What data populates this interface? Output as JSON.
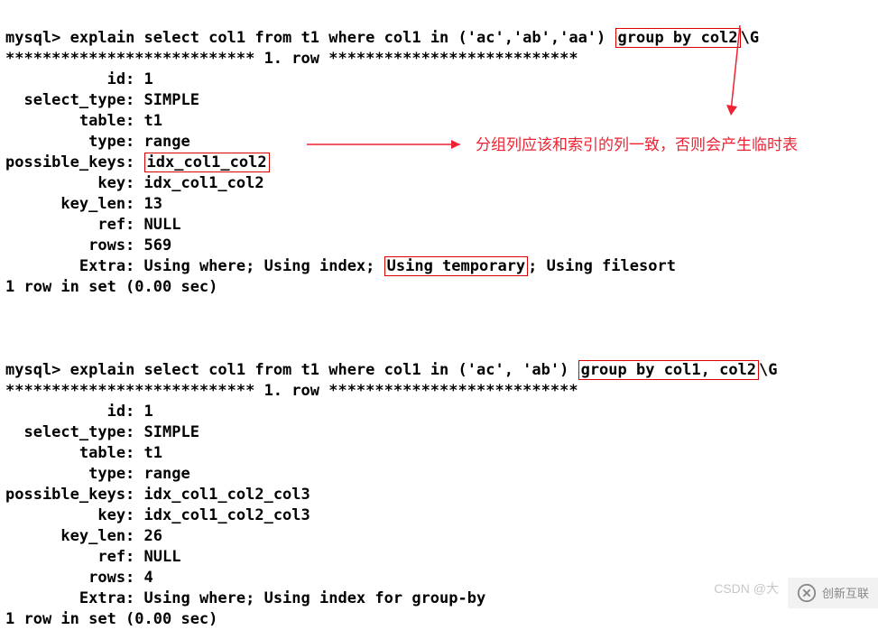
{
  "q1": {
    "prompt": "mysql> ",
    "sql_before": "explain select col1 from t1 where col1 in ('ac','ab','aa') ",
    "sql_box": "group by col2",
    "sql_after": "\\G",
    "sep": "*************************** 1. row ***************************",
    "rows": {
      "id": "1",
      "select_type": "SIMPLE",
      "table": "t1",
      "type": "range",
      "possible_keys": "idx_col1_col2",
      "key": "idx_col1_col2",
      "key_len": "13",
      "ref": "NULL",
      "rows_n": "569",
      "extra_before": "Using where; Using index; ",
      "extra_box": "Using temporary",
      "extra_after": "; Using filesort"
    },
    "timing": "1 row in set (0.00 sec)"
  },
  "q2": {
    "prompt": "mysql> ",
    "sql_before": "explain select col1 from t1 where col1 in ('ac', 'ab') ",
    "sql_box": "group by col1, col2",
    "sql_after": "\\G",
    "sep": "*************************** 1. row ***************************",
    "rows": {
      "id": "1",
      "select_type": "SIMPLE",
      "table": "t1",
      "type": "range",
      "possible_keys": "idx_col1_col2_col3",
      "key": "idx_col1_col2_col3",
      "key_len": "26",
      "ref": "NULL",
      "rows_n": "4",
      "extra": "Using where; Using index for group-by"
    },
    "timing": "1 row in set (0.00 sec)"
  },
  "labels": {
    "id": "           id: ",
    "select_type": "  select_type: ",
    "table": "        table: ",
    "type": "         type: ",
    "possible_keys": "possible_keys: ",
    "key": "          key: ",
    "key_len": "      key_len: ",
    "ref": "          ref: ",
    "rows": "         rows: ",
    "extra": "        Extra: "
  },
  "annotation": {
    "text": "分组列应该和索引的列一致，否则会产生临时表"
  },
  "watermark": "CSDN @大",
  "logo_text": "创新互联"
}
